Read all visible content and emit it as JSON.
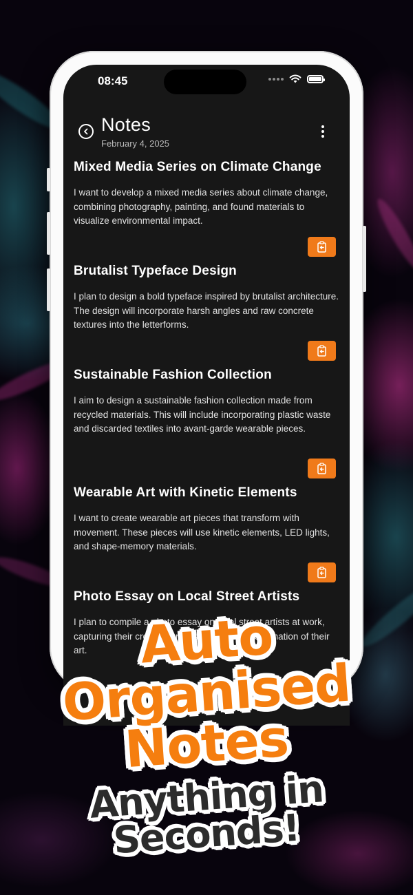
{
  "status_bar": {
    "time": "08:45"
  },
  "header": {
    "title": "Notes",
    "date": "February 4, 2025"
  },
  "notes": [
    {
      "title": "Mixed Media Series on Climate Change",
      "body": "I want to develop a mixed media series about climate change, combining photography, painting, and found materials to visualize environmental impact."
    },
    {
      "title": "Brutalist Typeface Design",
      "body": "I plan to design a bold typeface inspired by brutalist architecture. The design will incorporate harsh angles and raw concrete textures into the letterforms."
    },
    {
      "title": "Sustainable Fashion Collection",
      "body": "I aim to design a sustainable fashion collection made from recycled materials. This will include incorporating plastic waste and discarded textiles into avant-garde wearable pieces."
    },
    {
      "title": "Wearable Art with Kinetic Elements",
      "body": "I want to create wearable art pieces that transform with movement. These pieces will use kinetic elements, LED lights, and shape-memory materials."
    },
    {
      "title": "Photo Essay on Local Street Artists",
      "body": "I plan to compile a photo essay on local street artists at work, capturing their creative process and the transformation of their art."
    }
  ],
  "promo": {
    "line1": "Auto",
    "line2": "Organised",
    "line3": "Notes",
    "line4": "Anything in",
    "line5": "Seconds!"
  },
  "colors": {
    "accent": "#f07a1a",
    "screen_bg": "#171717",
    "promo_orange": "#f57e0f",
    "promo_dark": "#2c2c2c"
  },
  "icons": {
    "back": "chevron-left-circle-icon",
    "more": "more-vertical-icon",
    "copy": "clipboard-copy-icon",
    "wifi": "wifi-icon",
    "battery": "battery-icon",
    "signal": "signal-icon"
  }
}
